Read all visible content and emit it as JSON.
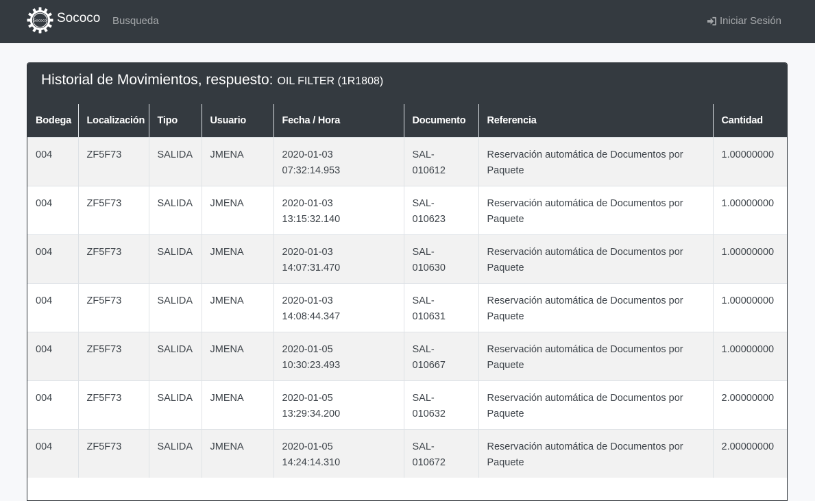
{
  "navbar": {
    "brand_text": "Sococo",
    "logo_text": "Sococo",
    "nav_link": "Busqueda",
    "login_label": "Iniciar Sesión"
  },
  "card": {
    "title": "Historial de Movimientos, respuesto:",
    "part": "OIL FILTER (1R1808)"
  },
  "table": {
    "headers": {
      "bodega": "Bodega",
      "localizacion": "Localización",
      "tipo": "Tipo",
      "usuario": "Usuario",
      "fecha": "Fecha / Hora",
      "documento": "Documento",
      "referencia": "Referencia",
      "cantidad": "Cantidad"
    },
    "rows": [
      {
        "bodega": "004",
        "localizacion": "ZF5F73",
        "tipo": "SALIDA",
        "usuario": "JMENA",
        "fecha": "2020-01-03",
        "hora": "07:32:14.953",
        "doc_prefix": "SAL-",
        "doc_num": "010612",
        "ref_line1": "Reservación automática de Documentos por",
        "ref_line2": "Paquete",
        "cantidad": "1.00000000"
      },
      {
        "bodega": "004",
        "localizacion": "ZF5F73",
        "tipo": "SALIDA",
        "usuario": "JMENA",
        "fecha": "2020-01-03",
        "hora": "13:15:32.140",
        "doc_prefix": "SAL-",
        "doc_num": "010623",
        "ref_line1": "Reservación automática de Documentos por",
        "ref_line2": "Paquete",
        "cantidad": "1.00000000"
      },
      {
        "bodega": "004",
        "localizacion": "ZF5F73",
        "tipo": "SALIDA",
        "usuario": "JMENA",
        "fecha": "2020-01-03",
        "hora": "14:07:31.470",
        "doc_prefix": "SAL-",
        "doc_num": "010630",
        "ref_line1": "Reservación automática de Documentos por",
        "ref_line2": "Paquete",
        "cantidad": "1.00000000"
      },
      {
        "bodega": "004",
        "localizacion": "ZF5F73",
        "tipo": "SALIDA",
        "usuario": "JMENA",
        "fecha": "2020-01-03",
        "hora": "14:08:44.347",
        "doc_prefix": "SAL-",
        "doc_num": "010631",
        "ref_line1": "Reservación automática de Documentos por",
        "ref_line2": "Paquete",
        "cantidad": "1.00000000"
      },
      {
        "bodega": "004",
        "localizacion": "ZF5F73",
        "tipo": "SALIDA",
        "usuario": "JMENA",
        "fecha": "2020-01-05",
        "hora": "10:30:23.493",
        "doc_prefix": "SAL-",
        "doc_num": "010667",
        "ref_line1": "Reservación automática de Documentos por",
        "ref_line2": "Paquete",
        "cantidad": "1.00000000"
      },
      {
        "bodega": "004",
        "localizacion": "ZF5F73",
        "tipo": "SALIDA",
        "usuario": "JMENA",
        "fecha": "2020-01-05",
        "hora": "13:29:34.200",
        "doc_prefix": "SAL-",
        "doc_num": "010632",
        "ref_line1": "Reservación automática de Documentos por",
        "ref_line2": "Paquete",
        "cantidad": "2.00000000"
      },
      {
        "bodega": "004",
        "localizacion": "ZF5F73",
        "tipo": "SALIDA",
        "usuario": "JMENA",
        "fecha": "2020-01-05",
        "hora": "14:24:14.310",
        "doc_prefix": "SAL-",
        "doc_num": "010672",
        "ref_line1": "Reservación automática de Documentos por",
        "ref_line2": "Paquete",
        "cantidad": "2.00000000"
      }
    ]
  }
}
